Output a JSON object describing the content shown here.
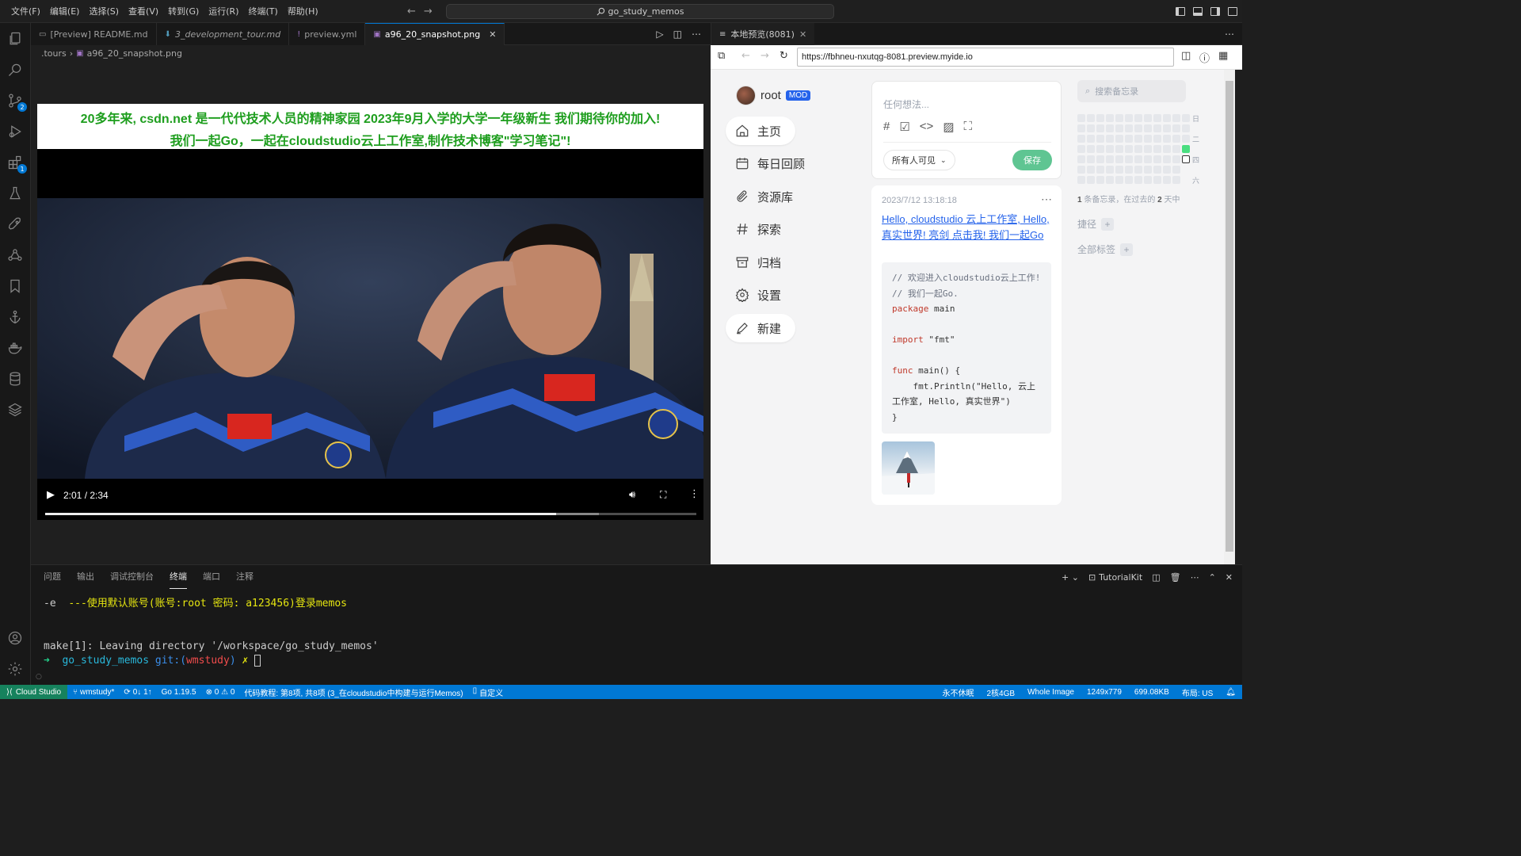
{
  "titlebar": {
    "menu": [
      "文件(F)",
      "编辑(E)",
      "选择(S)",
      "查看(V)",
      "转到(G)",
      "运行(R)",
      "终端(T)",
      "帮助(H)"
    ],
    "search": "go_study_memos"
  },
  "activitybar": {
    "scm_badge": "2",
    "extensions_badge": "1"
  },
  "editor": {
    "tabs": [
      {
        "label": "[Preview] README.md",
        "icon": "preview-icon",
        "italic": false
      },
      {
        "label": "3_development_tour.md",
        "icon": "markdown-icon",
        "italic": true
      },
      {
        "label": "preview.yml",
        "icon": "yaml-icon",
        "italic": false
      },
      {
        "label": "a96_20_snapshot.png",
        "icon": "image-icon",
        "italic": false
      }
    ],
    "breadcrumb": [
      ".tours",
      "a96_20_snapshot.png"
    ]
  },
  "image": {
    "banner_line1": "20多年来, csdn.net 是一代代技术人员的精神家园 2023年9月入学的大学一年级新生 我们期待你的加入!",
    "banner_line2": "我们一起Go，一起在cloudstudio云上工作室,制作技术博客\"学习笔记\"!",
    "video_time": "2:01 / 2:34",
    "video_progress": 0.785,
    "video_buffered": 0.85
  },
  "preview": {
    "tab_label": "本地预览(8081)",
    "url": "https://fbhneu-nxutqg-8081.preview.myide.io"
  },
  "memos": {
    "username": "root",
    "badge": "MOD",
    "nav": [
      {
        "label": "主页",
        "icon": "home-icon",
        "active": true
      },
      {
        "label": "每日回顾",
        "icon": "calendar-icon",
        "active": false
      },
      {
        "label": "资源库",
        "icon": "paperclip-icon",
        "active": false
      },
      {
        "label": "探索",
        "icon": "hash-icon",
        "active": false
      },
      {
        "label": "归档",
        "icon": "archive-icon",
        "active": false
      },
      {
        "label": "设置",
        "icon": "gear-icon",
        "active": false
      },
      {
        "label": "新建",
        "icon": "pen-icon",
        "active": true
      }
    ],
    "editor_placeholder": "任何想法...",
    "visibility": "所有人可见",
    "save": "保存",
    "memo_time": "2023/7/12 13:18:18",
    "memo_link": "Hello, cloudstudio 云上工作室, Hello, 真实世界! 亮剑 点击我! 我们一起Go",
    "memo_code": [
      "// 欢迎进入cloudstudio云上工作!",
      "// 我们一起Go.",
      "package main",
      "",
      "import \"fmt\"",
      "",
      "func main() {",
      "    fmt.Println(\"Hello, 云上工作室, Hello, 真实世界\")",
      "}"
    ],
    "search_placeholder": "搜索备忘录",
    "heatmap_days": [
      "日",
      "二",
      "四",
      "六"
    ],
    "heatmap_stat_count": "1",
    "heatmap_stat_mid": " 条备忘录，在过去的 ",
    "heatmap_stat_days": "2",
    "heatmap_stat_end": " 天中",
    "shortcuts_label": "捷径",
    "tags_label": "全部标签"
  },
  "panel": {
    "tabs": [
      "问题",
      "输出",
      "调试控制台",
      "终端",
      "端口",
      "注释"
    ],
    "active_tab": "终端",
    "tutorialkit": "TutorialKit",
    "term_line1_prefix": "-e  ",
    "term_line1_msg": "---使用默认账号(账号:root 密码: a123456)登录memos",
    "term_line2": "make[1]: Leaving directory '/workspace/go_study_memos'",
    "term_prompt_dir": "go_study_memos",
    "term_prompt_git": "git:(",
    "term_prompt_branch": "wmstudy",
    "term_prompt_close": ")",
    "term_prompt_x": "✗"
  },
  "statusbar": {
    "remote": "Cloud Studio",
    "branch": "wmstudy*",
    "sync": "0↓ 1↑",
    "go": "Go 1.19.5",
    "problems": "⊗ 0 ⚠ 0",
    "tutorial": "代码教程: 第8项, 共8项 (3_在cloudstudio中构建与运行Memos)",
    "custom": "自定义",
    "right": [
      "永不休眠",
      "2核4GB",
      "Whole Image",
      "1249x779",
      "699.08KB",
      "布局: US"
    ]
  },
  "colors": {
    "accent": "#0078d4",
    "remote": "#16825d",
    "banner_text": "#1e9e1e",
    "save_button": "#5fc592",
    "heatmap_active": "#4ade80"
  }
}
